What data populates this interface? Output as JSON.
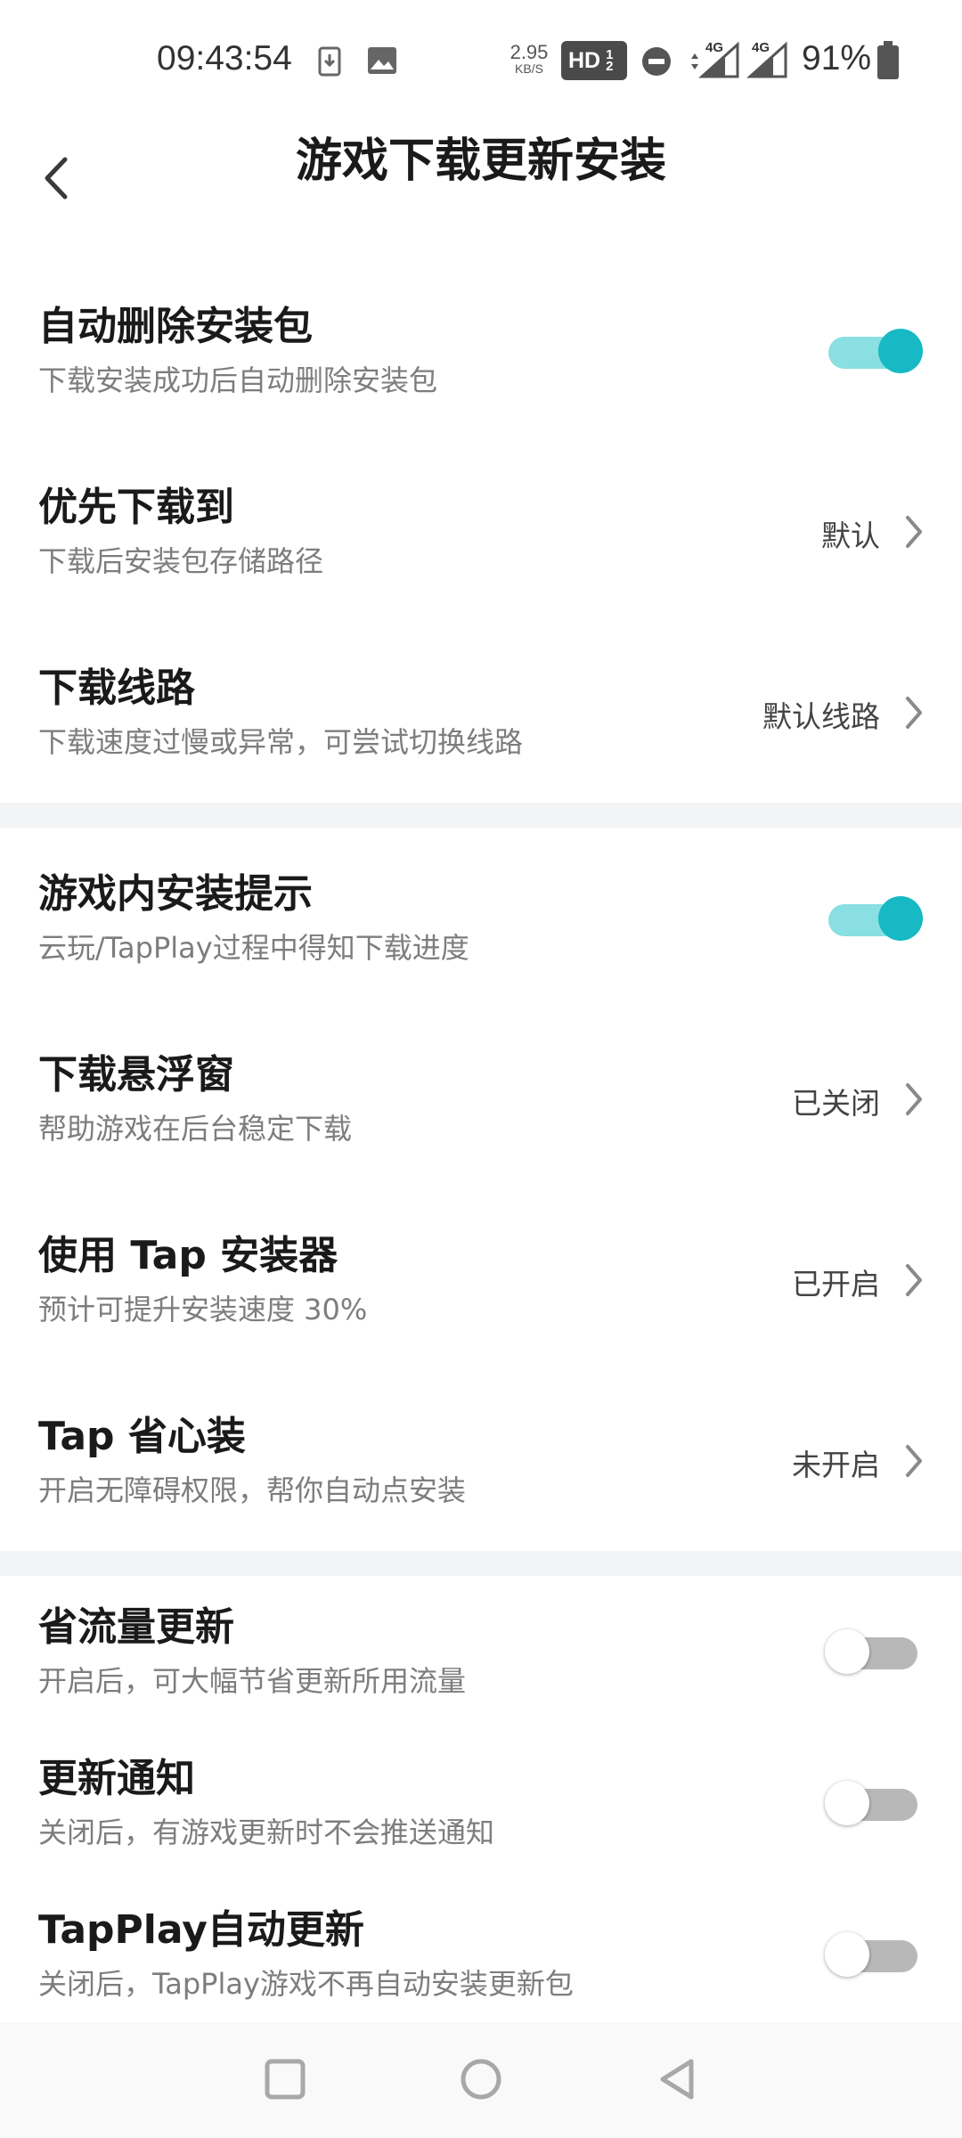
{
  "status_bar": {
    "time": "09:43:54",
    "net_speed_value": "2.95",
    "net_speed_unit": "KB/S",
    "hd_label": "HD",
    "hd_sub1": "1",
    "hd_sub2": "2",
    "sig1": "4G",
    "sig2": "4G",
    "battery": "91%"
  },
  "header": {
    "title": "游戏下载更新安装"
  },
  "sections": [
    [
      {
        "title": "自动删除安装包",
        "subtitle": "下载安装成功后自动删除安装包",
        "control": "toggle",
        "on": true
      },
      {
        "title": "优先下载到",
        "subtitle": "下载后安装包存储路径",
        "control": "link",
        "value": "默认"
      },
      {
        "title": "下载线路",
        "subtitle": "下载速度过慢或异常，可尝试切换线路",
        "control": "link",
        "value": "默认线路"
      }
    ],
    [
      {
        "title": "游戏内安装提示",
        "subtitle": "云玩/TapPlay过程中得知下载进度",
        "control": "toggle",
        "on": true
      },
      {
        "title": "下载悬浮窗",
        "subtitle": "帮助游戏在后台稳定下载",
        "control": "link",
        "value": "已关闭"
      },
      {
        "title": "使用 Tap 安装器",
        "subtitle": "预计可提升安装速度 30%",
        "control": "link",
        "value": "已开启"
      },
      {
        "title": "Tap 省心装",
        "subtitle": "开启无障碍权限，帮你自动点安装",
        "control": "link",
        "value": "未开启"
      }
    ],
    [
      {
        "title": "省流量更新",
        "subtitle": "开启后，可大幅节省更新所用流量",
        "control": "toggle",
        "on": false
      },
      {
        "title": "更新通知",
        "subtitle": "关闭后，有游戏更新时不会推送通知",
        "control": "toggle",
        "on": false
      },
      {
        "title": "TapPlay自动更新",
        "subtitle": "关闭后，TapPlay游戏不再自动安装更新包",
        "control": "toggle",
        "on": false
      }
    ]
  ],
  "colors": {
    "accent": "#16b9c4",
    "accent_track": "#89dfe2",
    "off_track": "#b8b8b8",
    "section_gap": "#f2f4f5"
  }
}
